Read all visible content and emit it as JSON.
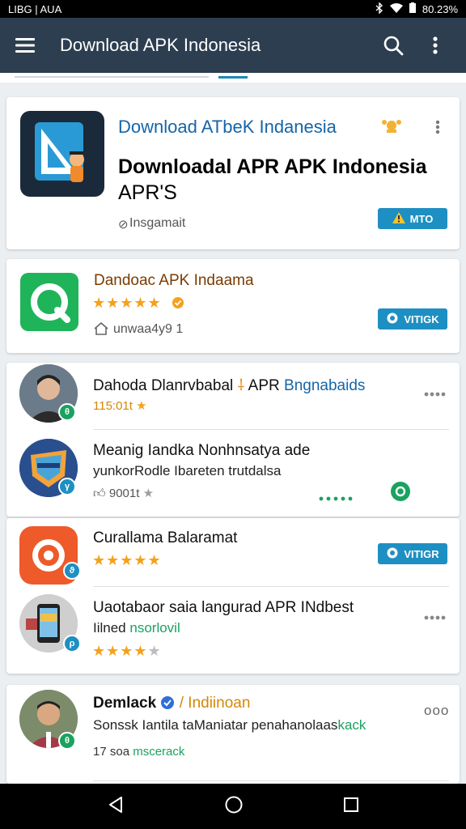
{
  "status_bar": {
    "left": "LIBG | AUA",
    "battery": "80.23%"
  },
  "app_bar": {
    "title": "Download APK Indonesia"
  },
  "featured": {
    "subtitle": "Download ATbeK Indanesia",
    "title": "Downloadal APR APK Indonesia",
    "title_line2": "APR'S",
    "meta": "Insgamait",
    "button": "MTO"
  },
  "second": {
    "title": "Dandoac APK Indaama",
    "meta": "unwaa4y9 1",
    "button": "VITIGK"
  },
  "list1": [
    {
      "title": "Dahoda Dlanrvbabal",
      "title_suffix": "APR",
      "title_accent": "Bngnabaids",
      "meta": "115:01t"
    },
    {
      "title": "Meanig Iandka Nonhnsatya ade",
      "sub": "yunkorRodle Ibareten trutdalsa",
      "meta": "9001t"
    },
    {
      "title": "Curallama Balaramat",
      "button": "VITIGR"
    },
    {
      "title": "Uaotabaor saia langurad APR INdbest",
      "sub": "Iilned",
      "sub_accent": "nsorlovil"
    }
  ],
  "bottom": {
    "title": "Demlack",
    "title_accent": "/ Indiinoan",
    "sub": "Sonssk Iantila taManiatar penahanolaas",
    "sub_accent": "kack",
    "meta": "17 soa",
    "meta_accent": "mscerack",
    "more": "ooo"
  },
  "colors": {
    "app_bar": "#2c3e50",
    "accent": "#1e8fc2",
    "star": "#f4a11b",
    "green": "#1aa260"
  }
}
